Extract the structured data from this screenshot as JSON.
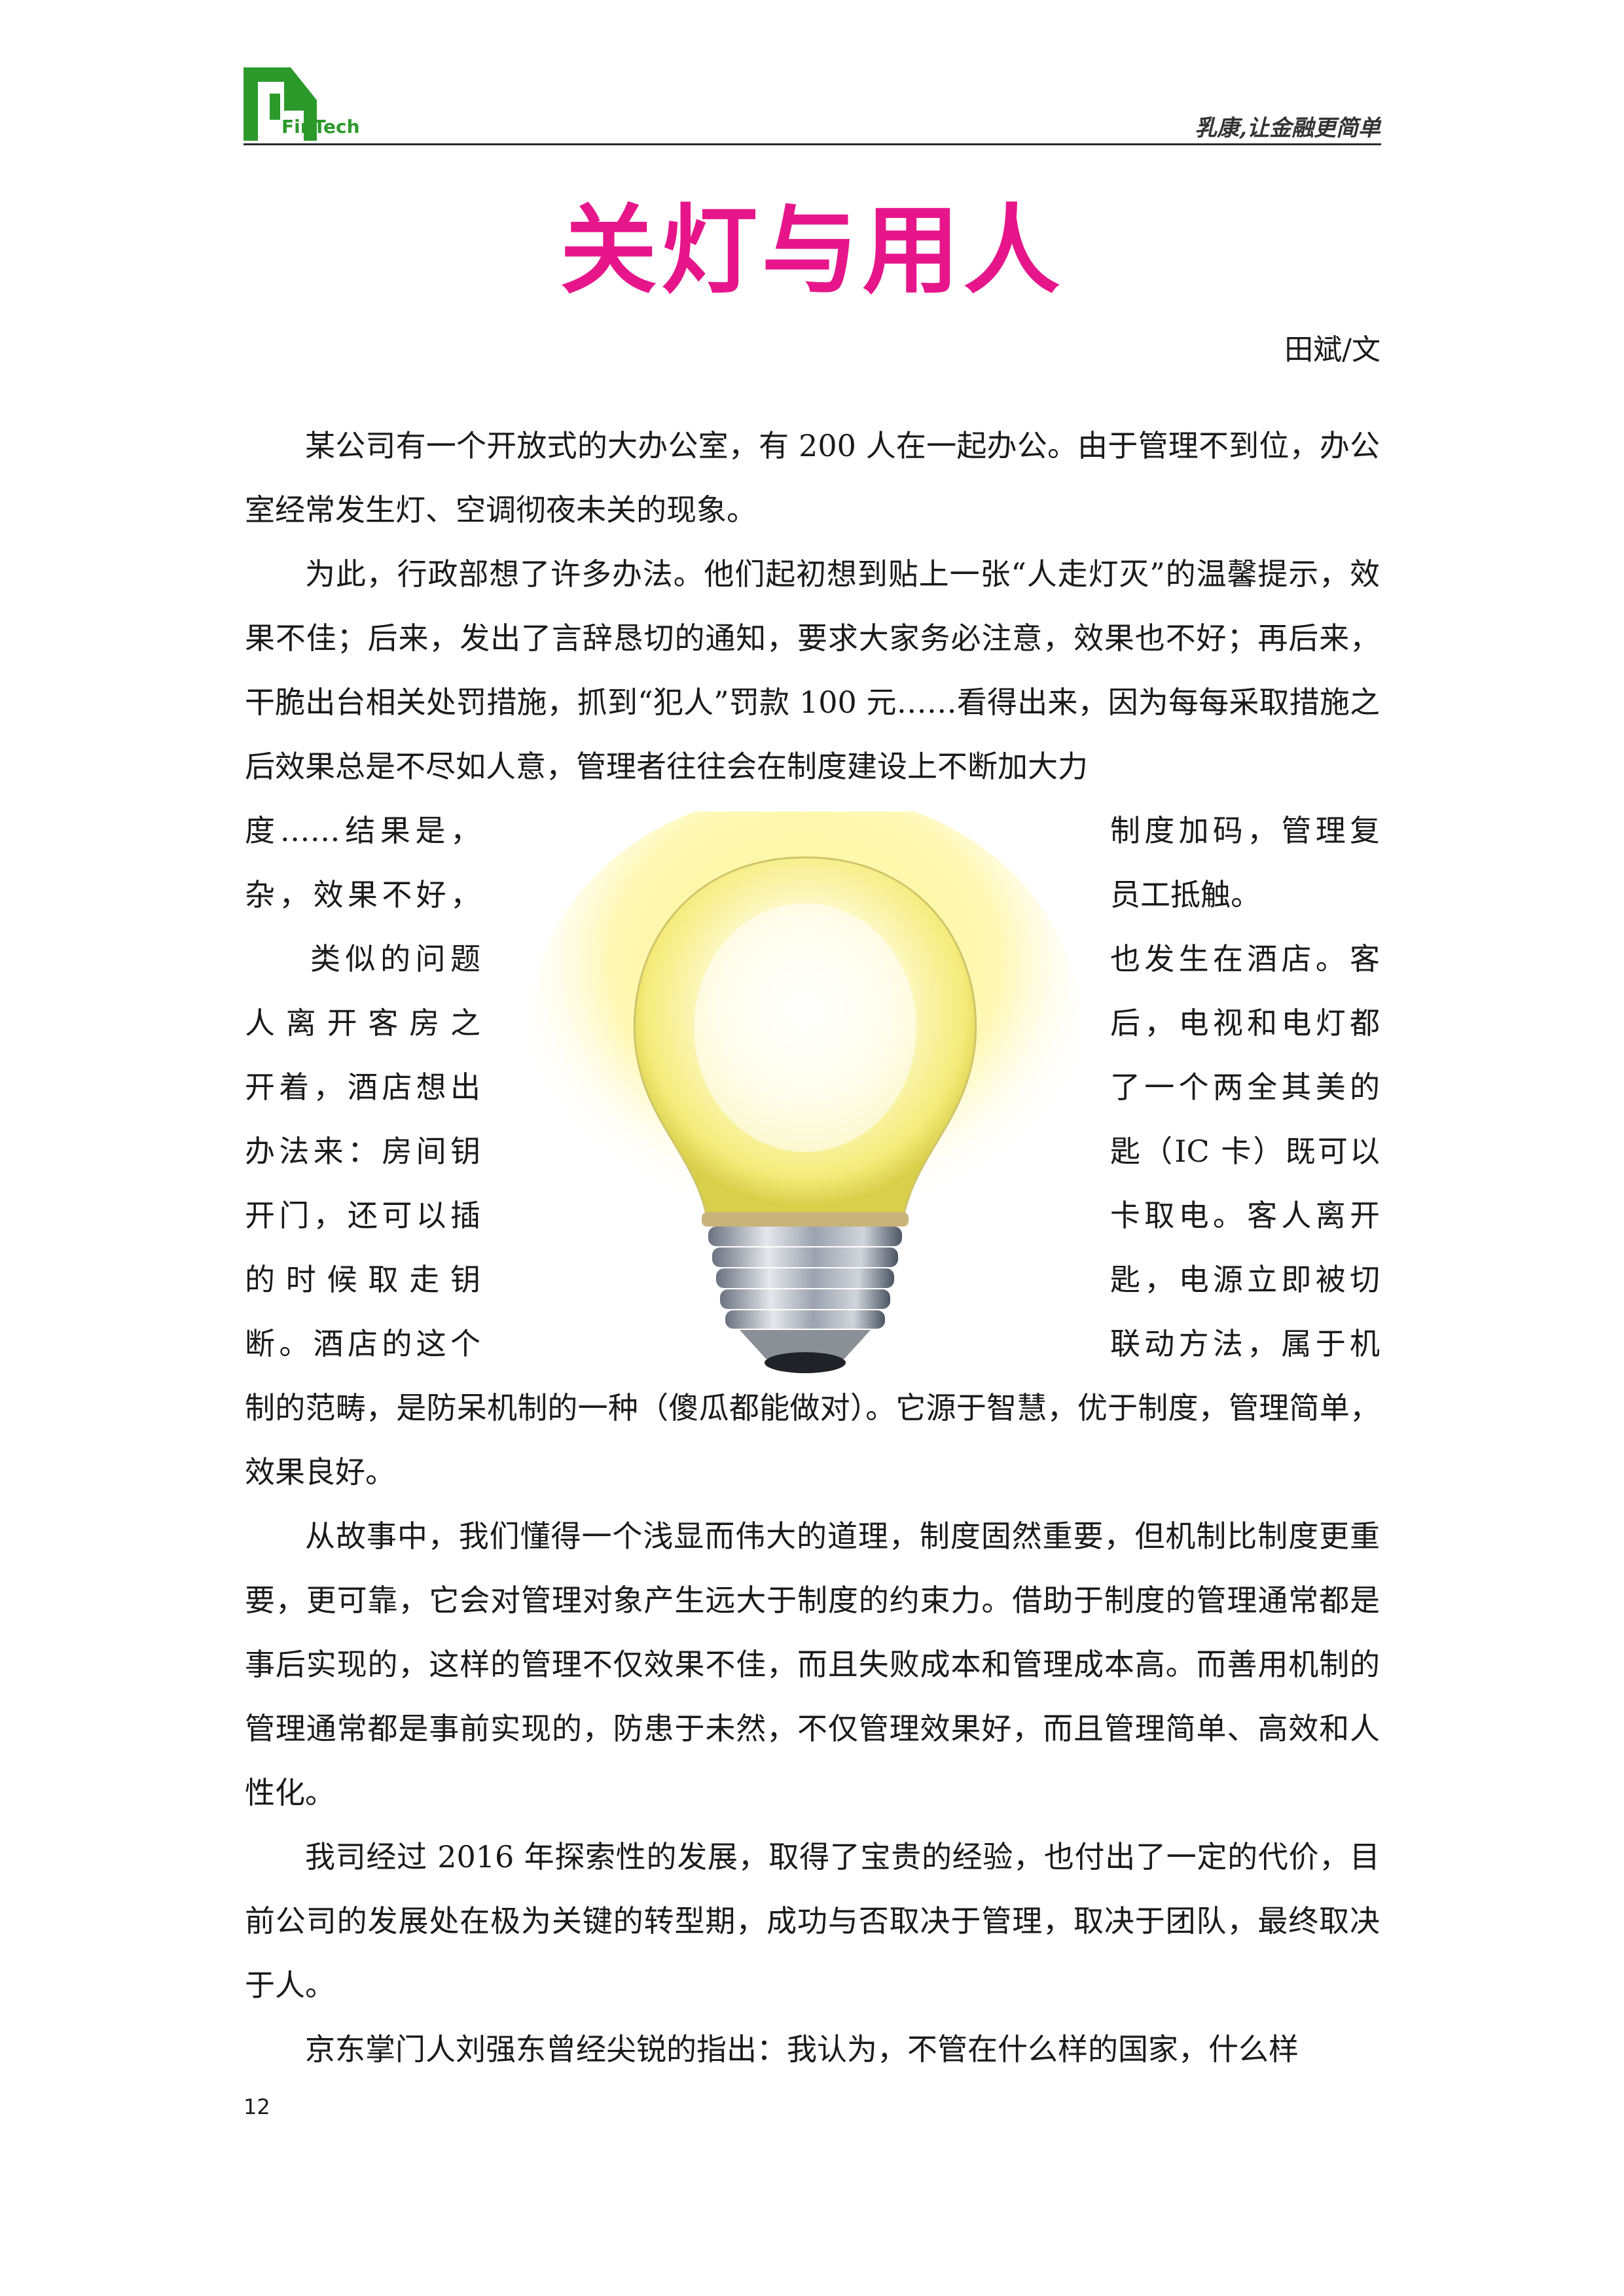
{
  "header": {
    "logo_text": "FinTech",
    "slogan": "乳康,让金融更简单",
    "logo_color": "#2b9a2b"
  },
  "article": {
    "title": "关灯与用人",
    "title_color": "#e6168a",
    "byline": "田斌/文",
    "para1": "某公司有一个开放式的大办公室，有 200 人在一起办公。由于管理不到位，办公室经常发生灯、空调彻夜未关的现象。",
    "para2": "为此，行政部想了许多办法。他们起初想到贴上一张“人走灯灭”的温馨提示，效果不佳；后来，发出了言辞恳切的通知，要求大家务必注意，效果也不好；再后来，干脆出台相关处罚措施，抓到“犯人”罚款 100 元……看得出来，因为每每采取措施之后效果总是不尽如人意，管理者往往会在制度建设上不断加大力",
    "wrap_left": [
      "度……结果是，",
      "杂，效果不好，",
      "类似的问题",
      "人离开客房之",
      "开着，酒店想出",
      "办法来：房间钥",
      "开门，还可以插",
      "的时候取走钥",
      "断。酒店的这个"
    ],
    "wrap_right": [
      "制度加码，管理复",
      "员工抵触。",
      "也发生在酒店。客",
      "后，电视和电灯都",
      "了一个两全其美的",
      "匙（IC 卡）既可以",
      "卡取电。客人离开",
      "匙，电源立即被切",
      "联动方法，属于机"
    ],
    "para3_tail": "制的范畴，是防呆机制的一种（傻瓜都能做对）。它源于智慧，优于制度，管理简单，效果良好。",
    "para4": "从故事中，我们懂得一个浅显而伟大的道理，制度固然重要，但机制比制度更重要，更可靠，它会对管理对象产生远大于制度的约束力。借助于制度的管理通常都是事后实现的，这样的管理不仅效果不佳，而且失败成本和管理成本高。而善用机制的管理通常都是事前实现的，防患于未然，不仅管理效果好，而且管理简单、高效和人性化。",
    "para5": "我司经过 2016 年探索性的发展，取得了宝贵的经验，也付出了一定的代价，目前公司的发展处在极为关键的转型期，成功与否取决于管理，取决于团队，最终取决于人。",
    "para6": "京东掌门人刘强东曾经尖锐的指出：我认为，不管在什么样的国家，什么样"
  },
  "footer": {
    "page_number": "12"
  }
}
